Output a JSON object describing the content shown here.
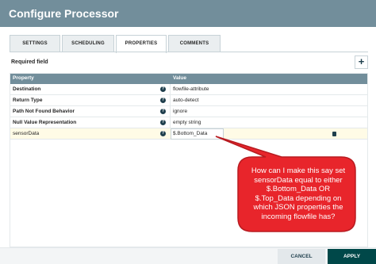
{
  "dialog": {
    "title": "Configure Processor"
  },
  "tabs": [
    {
      "label": "SETTINGS"
    },
    {
      "label": "SCHEDULING"
    },
    {
      "label": "PROPERTIES"
    },
    {
      "label": "COMMENTS"
    }
  ],
  "active_tab": "PROPERTIES",
  "properties": {
    "required_label": "Required field",
    "add_label": "+",
    "columns": {
      "property": "Property",
      "value": "Value"
    },
    "rows": [
      {
        "name": "Destination",
        "value": "flowfile-attribute",
        "help": "?"
      },
      {
        "name": "Return Type",
        "value": "auto-detect",
        "help": "?"
      },
      {
        "name": "Path Not Found Behavior",
        "value": "ignore",
        "help": "?"
      },
      {
        "name": "Null Value Representation",
        "value": "empty string",
        "help": "?"
      },
      {
        "name": "sensorData",
        "value": "$.Bottom_Data",
        "help": "?"
      }
    ]
  },
  "callout": {
    "text": "How can I make this say set sensorData equal to either $.Bottom_Data OR $.Top_Data depending on which JSON properties the incoming flowfile has?",
    "color": "#e8252b"
  },
  "footer": {
    "cancel_label": "CANCEL",
    "apply_label": "APPLY"
  },
  "colors": {
    "header": "#728e9b",
    "apply": "#004849",
    "selected_row": "#fffbe6"
  }
}
